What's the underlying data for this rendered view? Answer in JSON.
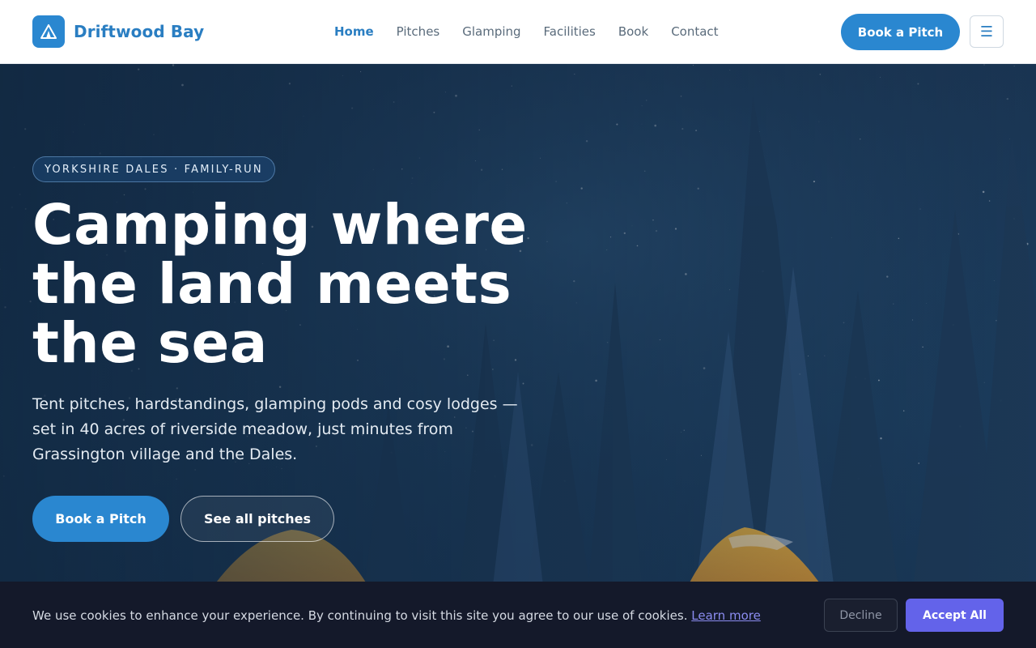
{
  "brand": {
    "name": "Driftwood Bay",
    "logo_icon": "tent-icon",
    "accent": "#2a87d0"
  },
  "nav": {
    "items": [
      {
        "label": "Home",
        "active": true
      },
      {
        "label": "Pitches",
        "active": false
      },
      {
        "label": "Glamping",
        "active": false
      },
      {
        "label": "Facilities",
        "active": false
      },
      {
        "label": "Book",
        "active": false
      },
      {
        "label": "Contact",
        "active": false
      }
    ],
    "cta_label": "Book a Pitch",
    "menu_icon": "hamburger-menu-icon"
  },
  "hero": {
    "badge": "YORKSHIRE DALES · FAMILY-RUN",
    "title": "Camping where the land meets the sea",
    "subtitle": "Tent pitches, hardstandings, glamping pods and cosy lodges — set in 40 acres of riverside meadow, just minutes from Grassington village and the Dales.",
    "primary_cta": "Book a Pitch",
    "secondary_cta": "See all pitches",
    "background": "night-forest-tents-photo"
  },
  "cookie": {
    "text": "We use cookies to enhance your experience. By continuing to visit this site you agree to our use of cookies.",
    "link_label": "Learn more",
    "decline_label": "Decline",
    "accept_label": "Accept All",
    "accept_color": "#6363ea"
  }
}
